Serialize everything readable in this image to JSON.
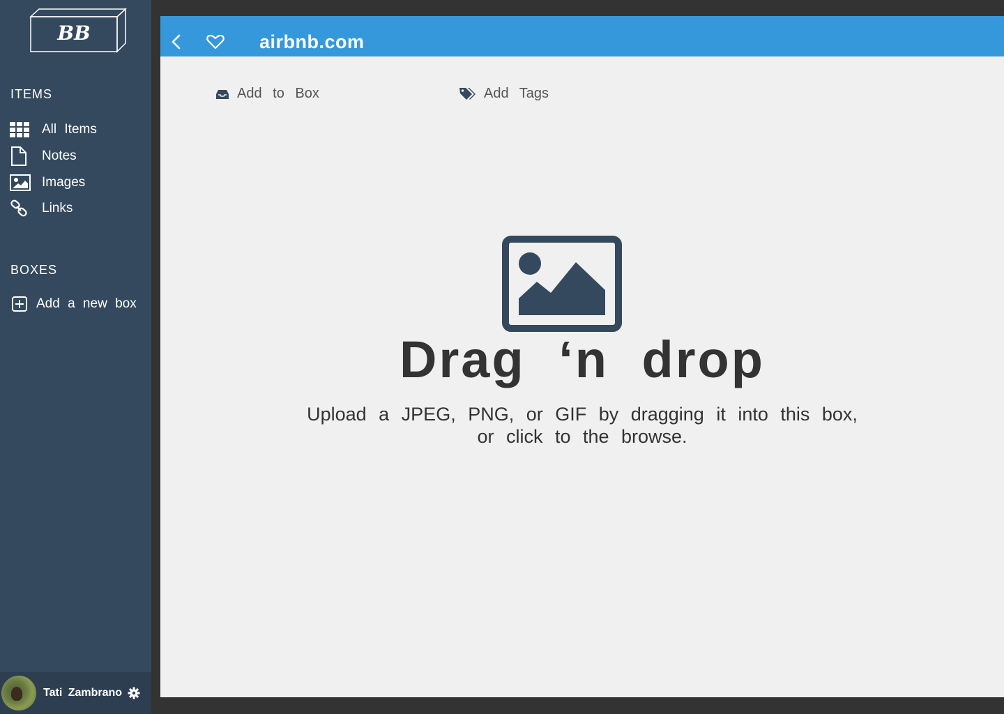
{
  "sidebar": {
    "logo_text": "BB",
    "items_title": "ITEMS",
    "items": [
      {
        "label": "All Items",
        "icon": "grid-icon"
      },
      {
        "label": "Notes",
        "icon": "document-icon"
      },
      {
        "label": "Images",
        "icon": "image-icon"
      },
      {
        "label": "Links",
        "icon": "link-icon"
      }
    ],
    "boxes_title": "BOXES",
    "add_box_label": "Add a new box",
    "user_name": "Tati Zambrano"
  },
  "topbar": {
    "title": "airbnb.com"
  },
  "actions": {
    "add_to_box": "Add to Box",
    "add_tags": "Add Tags"
  },
  "dropzone": {
    "title": "Drag ‘n drop",
    "subtitle_line1": "Upload a JPEG, PNG, or GIF by dragging it into this box,",
    "subtitle_line2": "or click to the browse."
  },
  "colors": {
    "sidebar_bg": "#34495e",
    "topbar_bg": "#3498db",
    "main_bg": "#f0f0f0",
    "text_dark": "#333333",
    "icon_navy": "#34495e"
  }
}
